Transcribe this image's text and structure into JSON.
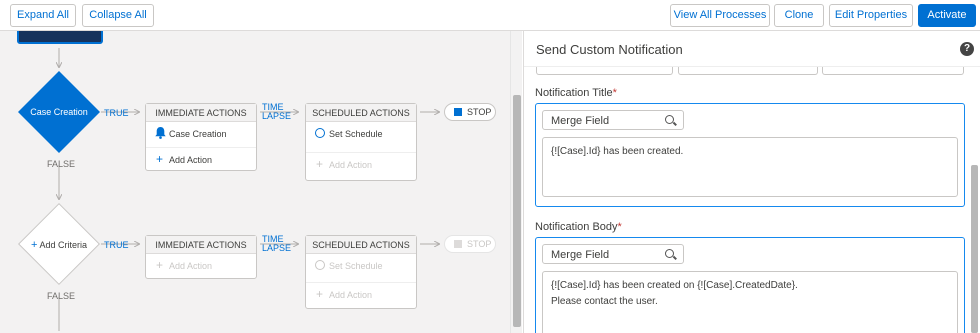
{
  "toolbar": {
    "expand_all": "Expand All",
    "collapse_all": "Collapse All",
    "view_all_processes": "View All Processes",
    "clone": "Clone",
    "edit_properties": "Edit Properties",
    "activate": "Activate"
  },
  "canvas": {
    "criteria1": {
      "label": "Case Creation",
      "true_label": "TRUE",
      "false_label": "FALSE"
    },
    "criteria2": {
      "label": "Add Criteria",
      "true_label": "TRUE",
      "false_label": "FALSE"
    },
    "immediate1": {
      "header": "IMMEDIATE ACTIONS",
      "action": "Case Creation",
      "add": "Add Action"
    },
    "scheduled1": {
      "header": "SCHEDULED ACTIONS",
      "schedule": "Set Schedule",
      "add": "Add Action"
    },
    "immediate2": {
      "header": "IMMEDIATE ACTIONS",
      "add": "Add Action"
    },
    "scheduled2": {
      "header": "SCHEDULED ACTIONS",
      "schedule": "Set Schedule",
      "add": "Add Action"
    },
    "time_lapse_1": "TIME",
    "time_lapse_2": "LAPSE",
    "stop": "STOP"
  },
  "panel": {
    "title": "Send Custom Notification",
    "help_icon": "?",
    "notification_title": {
      "label": "Notification Title",
      "required": "*",
      "merge_field": "Merge Field",
      "value": "{![Case].Id} has been created."
    },
    "notification_body": {
      "label": "Notification Body",
      "required": "*",
      "merge_field": "Merge Field",
      "line1": "{![Case].Id} has been created on {![Case].CreatedDate}.",
      "line2": "Please contact the user."
    }
  },
  "colors": {
    "brand": "#0070d2",
    "canvas_bg": "#f3f2f2",
    "focus_border": "#1589ee"
  }
}
